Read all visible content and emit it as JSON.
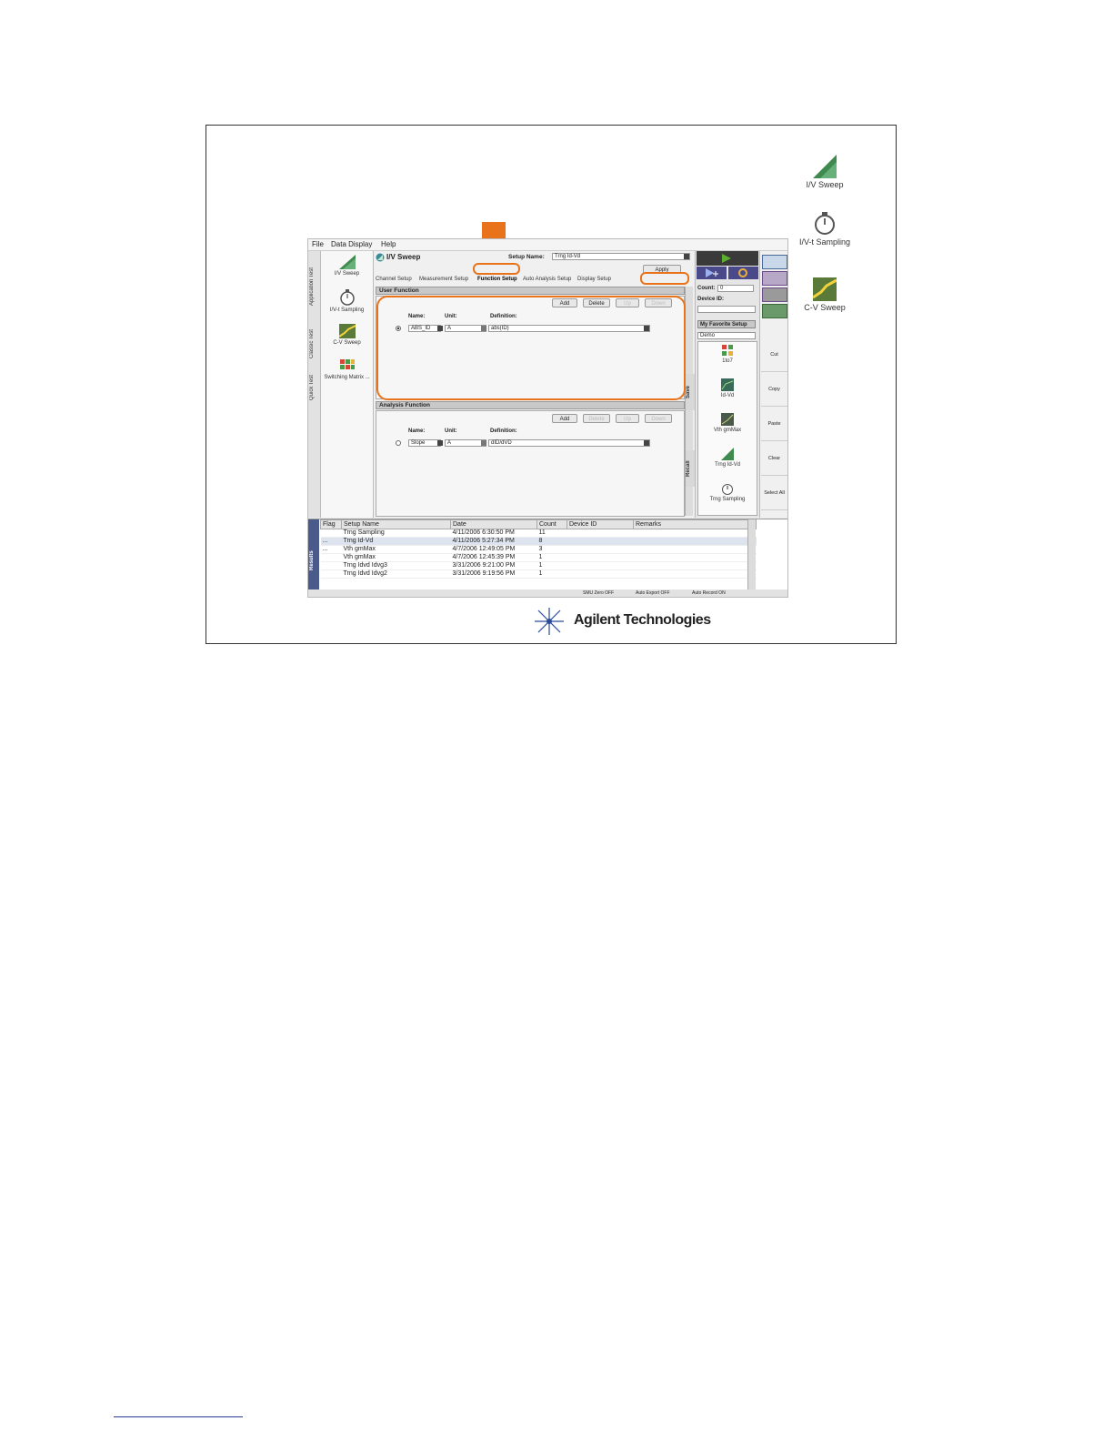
{
  "menu": [
    "File",
    "Data Display",
    "Help"
  ],
  "vertical_tabs": [
    "Application Test",
    "Classic Test",
    "Quick Test"
  ],
  "applications": [
    {
      "label": "I/V Sweep",
      "icon": "iv-sweep-icon"
    },
    {
      "label": "I/V-t Sampling",
      "icon": "stopwatch-icon"
    },
    {
      "label": "C-V Sweep",
      "icon": "cv-sweep-icon"
    },
    {
      "label": "Switching Matrix ...",
      "icon": "switching-matrix-icon"
    }
  ],
  "header": {
    "title": "I/V Sweep",
    "setup_name_label": "Setup Name:",
    "setup_name_value": "Trng Id-Vd"
  },
  "tabs": [
    "Channel Setup",
    "Measurement Setup",
    "Function Setup",
    "Auto Analysis Setup",
    "Display Setup"
  ],
  "active_tab": "Function Setup",
  "apply_label": "Apply",
  "user_function": {
    "section_title": "User Function",
    "buttons": [
      "Add",
      "Delete",
      "Up",
      "Down"
    ],
    "col_name": "Name:",
    "col_unit": "Unit:",
    "col_definition": "Definition:",
    "row": {
      "name": "ABS_ID",
      "unit": "A",
      "definition": "abs(ID)"
    }
  },
  "analysis_function": {
    "section_title": "Analysis Function",
    "buttons": [
      "Add",
      "Delete",
      "Up",
      "Down"
    ],
    "col_name": "Name:",
    "col_unit": "Unit:",
    "col_definition": "Definition:",
    "row": {
      "name": "Slope",
      "unit": "A",
      "definition": "dID/dVD"
    }
  },
  "right_panel": {
    "count_label": "Count:",
    "count_value": "0",
    "device_id_label": "Device ID:",
    "favorite_label": "My Favorite Setup",
    "favorite_value": "Demo",
    "side_save": "Save",
    "side_recall": "Recall",
    "favorites": [
      "1to7",
      "Id-Vd",
      "Vth gmMax",
      "Trng Id-Vd",
      "Trng Sampling"
    ]
  },
  "function_buttons": [
    "Cut",
    "Copy",
    "Paste",
    "Clear",
    "Select All"
  ],
  "results": {
    "tab_label": "Results",
    "columns": [
      "Flag",
      "Setup Name",
      "Date",
      "Count",
      "Device ID",
      "Remarks"
    ],
    "rows": [
      {
        "flag": "",
        "setup": "Trng Sampling",
        "date": "4/11/2006 6:30:50 PM",
        "count": "11"
      },
      {
        "flag": "...",
        "setup": "Trng Id-Vd",
        "date": "4/11/2006 5:27:34 PM",
        "count": "8"
      },
      {
        "flag": "...",
        "setup": "Vth gmMax",
        "date": "4/7/2006 12:49:05 PM",
        "count": "3"
      },
      {
        "flag": "",
        "setup": "Vth gmMax",
        "date": "4/7/2006 12:45:39 PM",
        "count": "1"
      },
      {
        "flag": "",
        "setup": "Trng Idvd Idvg3",
        "date": "3/31/2006 9:21:00 PM",
        "count": "1"
      },
      {
        "flag": "",
        "setup": "Trng Idvd Idvg2",
        "date": "3/31/2006 9:19:56 PM",
        "count": "1"
      }
    ]
  },
  "status": [
    "SMU Zero OFF",
    "Auto Export OFF",
    "Auto Record ON"
  ],
  "desktop_icons": [
    {
      "label": "I/V Sweep",
      "icon": "iv-sweep-icon"
    },
    {
      "label": "I/V-t Sampling",
      "icon": "stopwatch-icon"
    },
    {
      "label": "C-V Sweep",
      "icon": "cv-sweep-icon"
    }
  ],
  "logo_text": "Agilent Technologies",
  "colors": {
    "highlight": "#e8731a",
    "run_green": "#5ab02e",
    "logo_blue": "#2a4a9a"
  }
}
